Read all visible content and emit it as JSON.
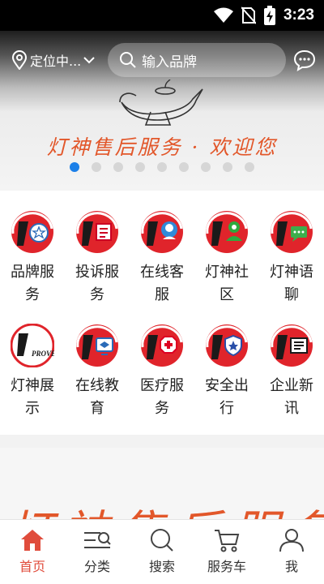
{
  "status": {
    "time": "3:23"
  },
  "header": {
    "location_label": "定位中...",
    "search_placeholder": "输入品牌"
  },
  "banner": {
    "title": "灯神售后服务 · 欢迎您",
    "page_count": 9,
    "active_index": 0
  },
  "services": [
    {
      "label": "品牌服务",
      "icon": "star-circle-icon"
    },
    {
      "label": "投诉服务",
      "icon": "complaint-icon"
    },
    {
      "label": "在线客服",
      "icon": "customer-service-icon"
    },
    {
      "label": "灯神社区",
      "icon": "community-icon"
    },
    {
      "label": "灯神语聊",
      "icon": "chat-icon"
    },
    {
      "label": "灯神展示",
      "icon": "prove-icon"
    },
    {
      "label": "在线教育",
      "icon": "education-icon"
    },
    {
      "label": "医疗服务",
      "icon": "medical-icon"
    },
    {
      "label": "安全出行",
      "icon": "shield-star-icon"
    },
    {
      "label": "企业新讯",
      "icon": "news-icon"
    }
  ],
  "banner2": {
    "text": "灯神售后服务"
  },
  "tabs": [
    {
      "label": "首页",
      "icon": "home-icon"
    },
    {
      "label": "分类",
      "icon": "category-icon"
    },
    {
      "label": "搜索",
      "icon": "search-icon"
    },
    {
      "label": "服务车",
      "icon": "cart-icon"
    },
    {
      "label": "我",
      "icon": "user-icon"
    }
  ],
  "colors": {
    "brand_red": "#e04c3c",
    "accent_blue": "#1b7fe8",
    "banner_orange": "#e2572a"
  }
}
